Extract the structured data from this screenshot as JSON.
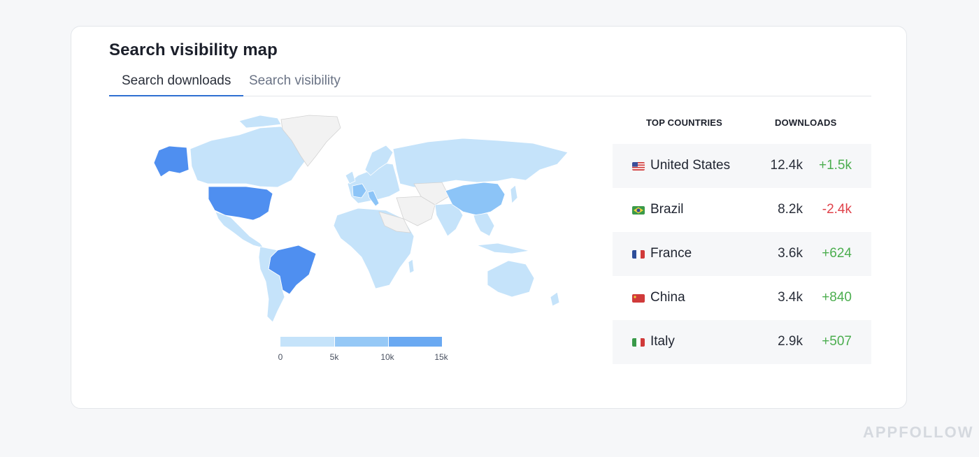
{
  "card": {
    "title": "Search visibility map"
  },
  "tabs": [
    {
      "label": "Search downloads",
      "active": true
    },
    {
      "label": "Search visibility",
      "active": false
    }
  ],
  "map": {
    "colors": {
      "none": "#f2f2f2",
      "low": "#c5e3fa",
      "mid": "#8cc4f7",
      "high": "#4f8ff0",
      "border": "#ffffff",
      "none_border": "#d3d3d3"
    },
    "legend": {
      "labels": [
        "0",
        "5k",
        "10k",
        "15k"
      ],
      "colors": [
        "#c5e3fa",
        "#95c8f6",
        "#6aa9f2",
        "#4285f0"
      ]
    }
  },
  "table": {
    "headers": {
      "countries": "TOP COUNTRIES",
      "downloads": "DOWNLOADS"
    },
    "rows": [
      {
        "flag": "us-flag-icon",
        "country": "United States",
        "downloads": "12.4k",
        "delta": "+1.5k",
        "trend": "pos"
      },
      {
        "flag": "br-flag-icon",
        "country": "Brazil",
        "downloads": "8.2k",
        "delta": "-2.4k",
        "trend": "neg"
      },
      {
        "flag": "fr-flag-icon",
        "country": "France",
        "downloads": "3.6k",
        "delta": "+624",
        "trend": "pos"
      },
      {
        "flag": "cn-flag-icon",
        "country": "China",
        "downloads": "3.4k",
        "delta": "+840",
        "trend": "pos"
      },
      {
        "flag": "it-flag-icon",
        "country": "Italy",
        "downloads": "2.9k",
        "delta": "+507",
        "trend": "pos"
      }
    ]
  },
  "brand": {
    "label": "APPFOLLOW"
  }
}
